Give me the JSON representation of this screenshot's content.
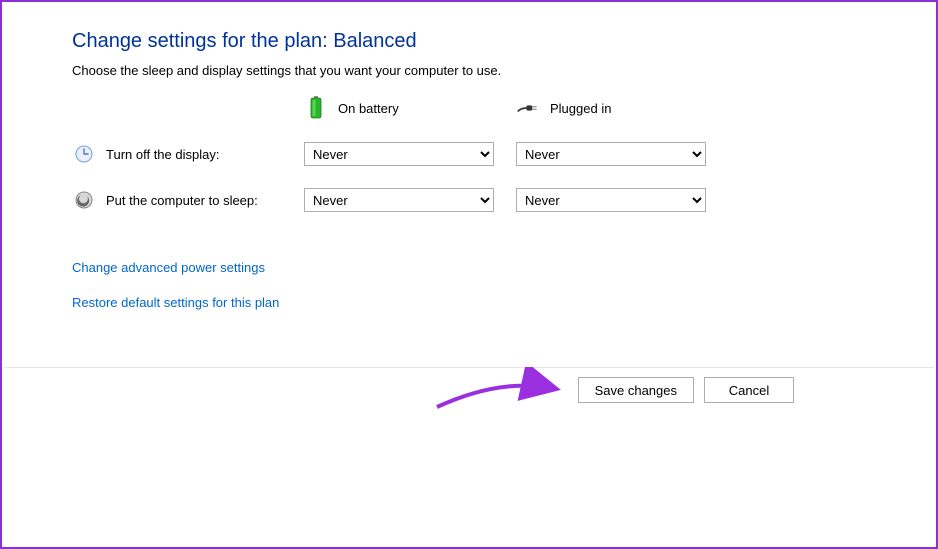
{
  "title": "Change settings for the plan: Balanced",
  "subtitle": "Choose the sleep and display settings that you want your computer to use.",
  "columns": {
    "battery": "On battery",
    "plugged": "Plugged in"
  },
  "rows": {
    "display": {
      "label": "Turn off the display:",
      "battery_value": "Never",
      "plugged_value": "Never"
    },
    "sleep": {
      "label": "Put the computer to sleep:",
      "battery_value": "Never",
      "plugged_value": "Never"
    }
  },
  "links": {
    "advanced": "Change advanced power settings",
    "restore": "Restore default settings for this plan"
  },
  "buttons": {
    "save": "Save changes",
    "cancel": "Cancel"
  }
}
